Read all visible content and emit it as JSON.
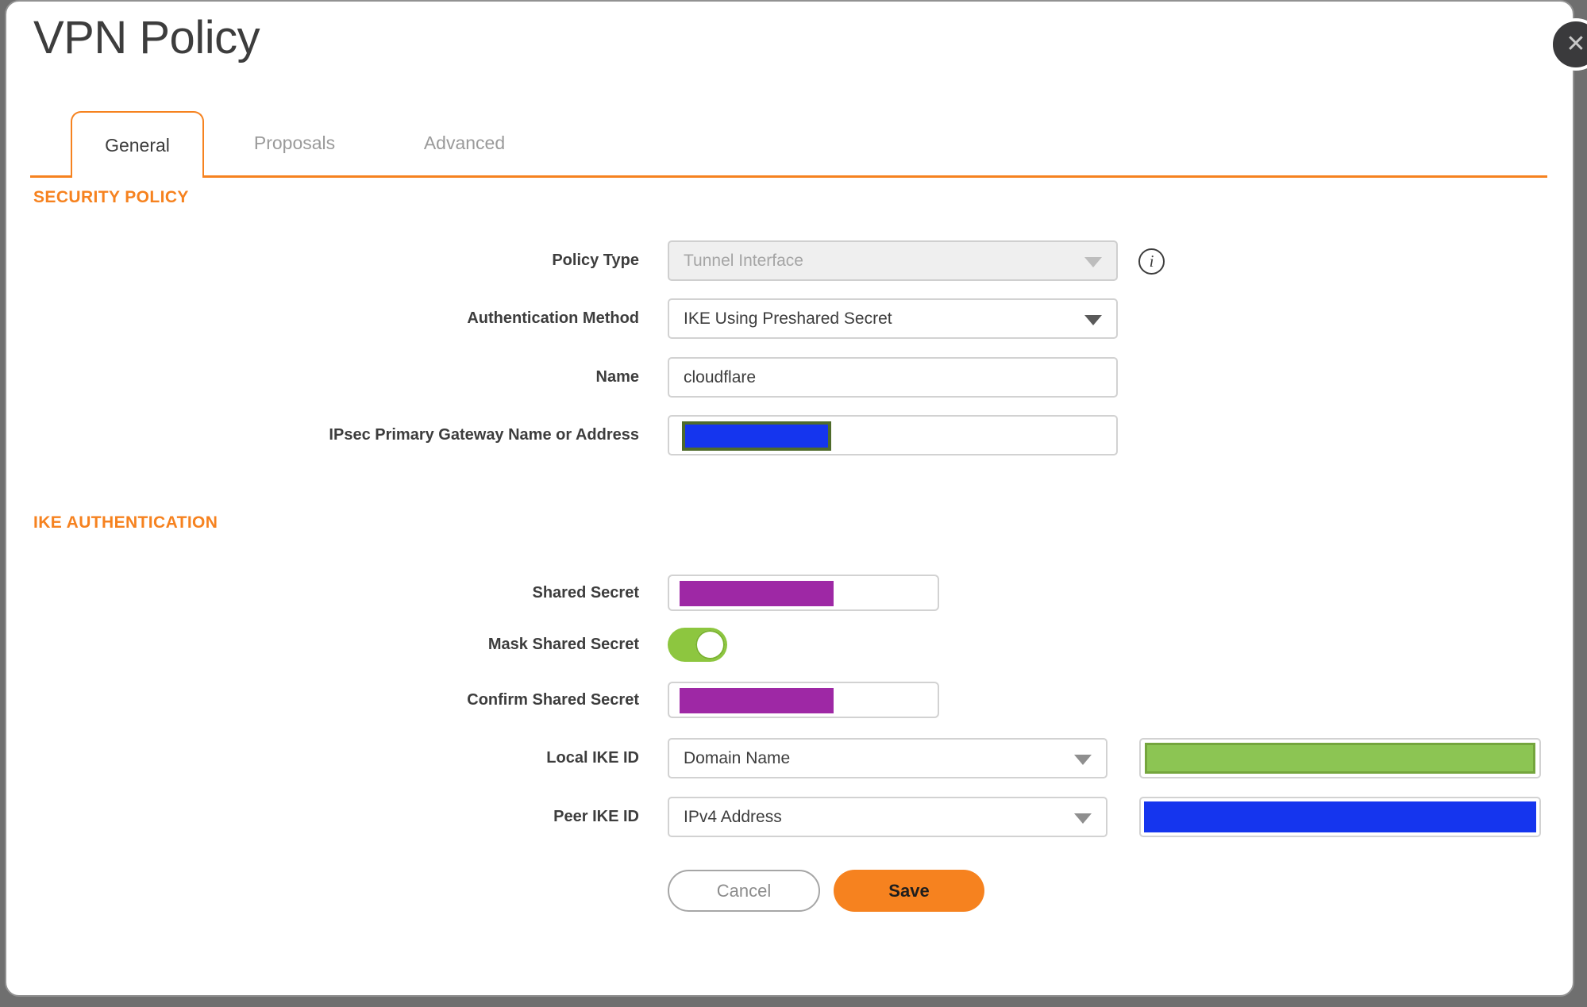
{
  "dialog": {
    "title": "VPN Policy"
  },
  "close": {
    "glyph": "✕"
  },
  "tabs": [
    {
      "label": "General",
      "active": true
    },
    {
      "label": "Proposals",
      "active": false
    },
    {
      "label": "Advanced",
      "active": false
    }
  ],
  "security_policy": {
    "heading": "SECURITY POLICY",
    "policy_type": {
      "label": "Policy Type",
      "value": "Tunnel Interface",
      "disabled": true
    },
    "auth_method": {
      "label": "Authentication Method",
      "value": "IKE Using Preshared Secret"
    },
    "name": {
      "label": "Name",
      "value": "cloudflare"
    },
    "gateway": {
      "label": "IPsec Primary Gateway Name or Address",
      "value_redacted": true
    }
  },
  "ike_authentication": {
    "heading": "IKE AUTHENTICATION",
    "shared_secret": {
      "label": "Shared Secret",
      "value_redacted": true
    },
    "mask_shared_secret": {
      "label": "Mask Shared Secret",
      "state": "on"
    },
    "confirm_shared_secret": {
      "label": "Confirm Shared Secret",
      "value_redacted": true
    },
    "local_ike_id": {
      "label": "Local IKE ID",
      "type": "Domain Name",
      "value_redacted": true
    },
    "peer_ike_id": {
      "label": "Peer IKE ID",
      "type": "IPv4 Address",
      "value_redacted": true
    }
  },
  "buttons": {
    "cancel": "Cancel",
    "save": "Save"
  },
  "info_icon_glyph": "i",
  "colors": {
    "orange": "#F6821F",
    "purple": "#9E28A5",
    "blue": "#1535EE",
    "olive_border": "#4F6B2B",
    "green_fill": "#8CC553",
    "green_border": "#74A53D",
    "toggle_green": "#8DC63F",
    "backdrop": "#6F6F6F",
    "text_dark": "#3D3D3D",
    "tab_inactive": "#9A9A9A",
    "disabled_bg": "#EFEFEF"
  }
}
